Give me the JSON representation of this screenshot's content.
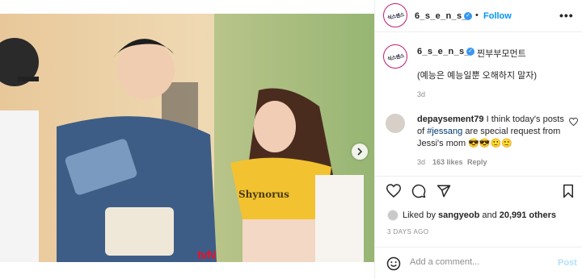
{
  "post": {
    "watermark": "tvN",
    "shirt_text": "Shynorus"
  },
  "header": {
    "username": "6_s_e_n_s_e",
    "separator": "•",
    "follow_label": "Follow",
    "more_label": "•••",
    "avatar_logo": "식스센스"
  },
  "caption": {
    "username": "6_s_e_n_s_e",
    "text_line1": "찐부부모먼트",
    "text_line2": "(예능은 예능일뿐 오해하지 말자)",
    "age": "3d"
  },
  "comment": {
    "username": "depaysement79",
    "text_before": " I think today's posts of ",
    "hashtag": "#jessang",
    "text_after": " are special request from Jessi's mom 😎😎🙂🙂",
    "age": "3d",
    "likes": "163 likes",
    "reply_label": "Reply"
  },
  "engagement": {
    "liked_by_prefix": "Liked by",
    "liked_by_user": "sangyeob",
    "liked_by_and": "and",
    "others": "20,991 others",
    "posted_ago": "3 DAYS AGO"
  },
  "composer": {
    "placeholder": "Add a comment...",
    "post_label": "Post"
  },
  "icons": [
    "heart-icon",
    "comment-icon",
    "share-icon",
    "bookmark-icon",
    "emoji-icon",
    "chevron-right-icon",
    "verified-icon"
  ],
  "colors": {
    "link_blue": "#0095f6",
    "verified_blue": "#3897f0",
    "watermark_red": "#e8112d",
    "shirt_yellow": "#f2c230"
  }
}
